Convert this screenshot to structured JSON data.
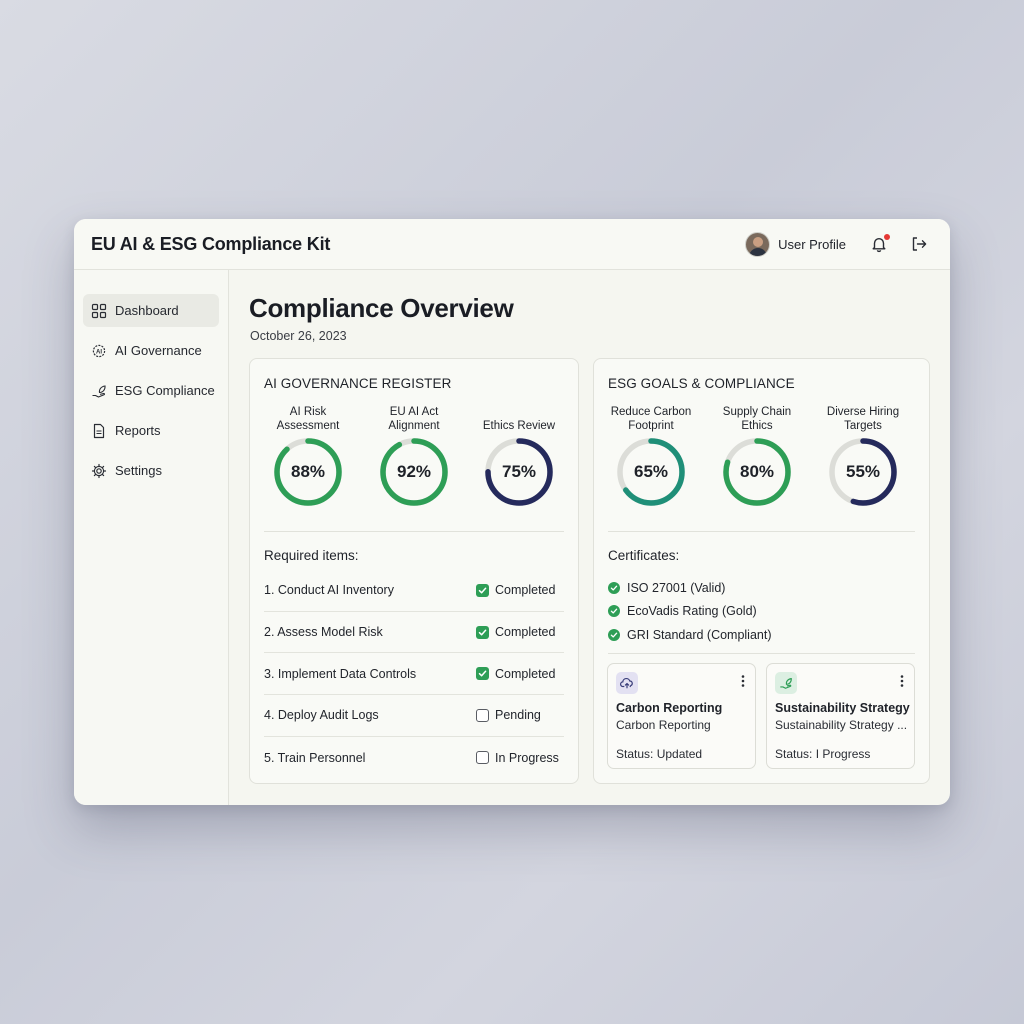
{
  "app": {
    "title": "EU AI & ESG Compliance Kit"
  },
  "header": {
    "user_label": "User Profile"
  },
  "sidebar": {
    "items": [
      {
        "label": "Dashboard",
        "icon": "dashboard-grid-icon",
        "active": true
      },
      {
        "label": "AI Governance",
        "icon": "ai-chip-icon"
      },
      {
        "label": "ESG Compliance",
        "icon": "leaf-hand-icon"
      },
      {
        "label": "Reports",
        "icon": "document-icon"
      },
      {
        "label": "Settings",
        "icon": "gear-icon"
      }
    ]
  },
  "main": {
    "title": "Compliance Overview",
    "date": "October 26, 2023",
    "ai_card": {
      "title": "AI GOVERNANCE REGISTER",
      "gauges": [
        {
          "label": "AI Risk Assessment",
          "value": 88,
          "display": "88%",
          "color": "#2e9e56"
        },
        {
          "label": "EU AI Act Alignment",
          "value": 92,
          "display": "92%",
          "color": "#2e9e56"
        },
        {
          "label": "Ethics Review",
          "value": 75,
          "display": "75%",
          "color": "#252a5c"
        }
      ],
      "required_label": "Required items:",
      "items": [
        {
          "name": "1. Conduct AI Inventory",
          "status": "Completed",
          "checked": true
        },
        {
          "name": "2. Assess Model Risk",
          "status": "Completed",
          "checked": true
        },
        {
          "name": "3. Implement Data Controls",
          "status": "Completed",
          "checked": true
        },
        {
          "name": "4. Deploy Audit Logs",
          "status": "Pending",
          "checked": false
        },
        {
          "name": "5. Train Personnel",
          "status": "In Progress",
          "checked": false
        }
      ]
    },
    "esg_card": {
      "title": "ESG GOALS & COMPLIANCE",
      "gauges": [
        {
          "label": "Reduce Carbon Footprint",
          "value": 65,
          "display": "65%",
          "color": "#1f8f78"
        },
        {
          "label": "Supply Chain Ethics",
          "value": 80,
          "display": "80%",
          "color": "#2e9e56"
        },
        {
          "label": "Diverse Hiring Targets",
          "value": 55,
          "display": "55%",
          "color": "#252a5c"
        }
      ],
      "certificates_label": "Certificates:",
      "certificates": [
        "ISO 27001 (Valid)",
        "EcoVadis Rating (Gold)",
        "GRI Standard (Compliant)"
      ],
      "mini_cards": [
        {
          "title": "Carbon Reporting",
          "subtitle": "Carbon Reporting",
          "status": "Status: Updated",
          "icon": "cloud-upload-icon",
          "icon_bg": "#e3e1f2",
          "icon_color": "#3b3f7a"
        },
        {
          "title": "Sustainability Strategy",
          "subtitle": "Sustainability Strategy ...",
          "status": "Status: I Progress",
          "icon": "leaf-hand-icon",
          "icon_bg": "#dcefe2",
          "icon_color": "#2e9e56"
        }
      ]
    }
  },
  "colors": {
    "track": "#dcddd8",
    "success": "#2e9e56",
    "navy": "#252a5c",
    "teal": "#1f8f78"
  }
}
